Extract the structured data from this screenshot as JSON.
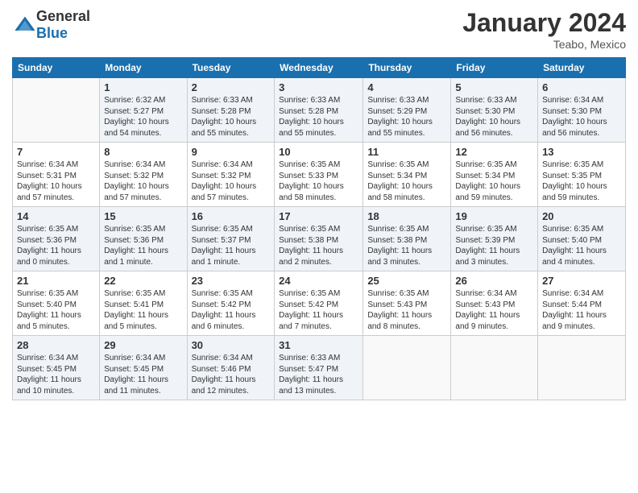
{
  "header": {
    "logo_general": "General",
    "logo_blue": "Blue",
    "month": "January 2024",
    "location": "Teabo, Mexico"
  },
  "days_of_week": [
    "Sunday",
    "Monday",
    "Tuesday",
    "Wednesday",
    "Thursday",
    "Friday",
    "Saturday"
  ],
  "weeks": [
    [
      {
        "day": "",
        "info": ""
      },
      {
        "day": "1",
        "info": "Sunrise: 6:32 AM\nSunset: 5:27 PM\nDaylight: 10 hours\nand 54 minutes."
      },
      {
        "day": "2",
        "info": "Sunrise: 6:33 AM\nSunset: 5:28 PM\nDaylight: 10 hours\nand 55 minutes."
      },
      {
        "day": "3",
        "info": "Sunrise: 6:33 AM\nSunset: 5:28 PM\nDaylight: 10 hours\nand 55 minutes."
      },
      {
        "day": "4",
        "info": "Sunrise: 6:33 AM\nSunset: 5:29 PM\nDaylight: 10 hours\nand 55 minutes."
      },
      {
        "day": "5",
        "info": "Sunrise: 6:33 AM\nSunset: 5:30 PM\nDaylight: 10 hours\nand 56 minutes."
      },
      {
        "day": "6",
        "info": "Sunrise: 6:34 AM\nSunset: 5:30 PM\nDaylight: 10 hours\nand 56 minutes."
      }
    ],
    [
      {
        "day": "7",
        "info": "Sunrise: 6:34 AM\nSunset: 5:31 PM\nDaylight: 10 hours\nand 57 minutes."
      },
      {
        "day": "8",
        "info": "Sunrise: 6:34 AM\nSunset: 5:32 PM\nDaylight: 10 hours\nand 57 minutes."
      },
      {
        "day": "9",
        "info": "Sunrise: 6:34 AM\nSunset: 5:32 PM\nDaylight: 10 hours\nand 57 minutes."
      },
      {
        "day": "10",
        "info": "Sunrise: 6:35 AM\nSunset: 5:33 PM\nDaylight: 10 hours\nand 58 minutes."
      },
      {
        "day": "11",
        "info": "Sunrise: 6:35 AM\nSunset: 5:34 PM\nDaylight: 10 hours\nand 58 minutes."
      },
      {
        "day": "12",
        "info": "Sunrise: 6:35 AM\nSunset: 5:34 PM\nDaylight: 10 hours\nand 59 minutes."
      },
      {
        "day": "13",
        "info": "Sunrise: 6:35 AM\nSunset: 5:35 PM\nDaylight: 10 hours\nand 59 minutes."
      }
    ],
    [
      {
        "day": "14",
        "info": "Sunrise: 6:35 AM\nSunset: 5:36 PM\nDaylight: 11 hours\nand 0 minutes."
      },
      {
        "day": "15",
        "info": "Sunrise: 6:35 AM\nSunset: 5:36 PM\nDaylight: 11 hours\nand 1 minute."
      },
      {
        "day": "16",
        "info": "Sunrise: 6:35 AM\nSunset: 5:37 PM\nDaylight: 11 hours\nand 1 minute."
      },
      {
        "day": "17",
        "info": "Sunrise: 6:35 AM\nSunset: 5:38 PM\nDaylight: 11 hours\nand 2 minutes."
      },
      {
        "day": "18",
        "info": "Sunrise: 6:35 AM\nSunset: 5:38 PM\nDaylight: 11 hours\nand 3 minutes."
      },
      {
        "day": "19",
        "info": "Sunrise: 6:35 AM\nSunset: 5:39 PM\nDaylight: 11 hours\nand 3 minutes."
      },
      {
        "day": "20",
        "info": "Sunrise: 6:35 AM\nSunset: 5:40 PM\nDaylight: 11 hours\nand 4 minutes."
      }
    ],
    [
      {
        "day": "21",
        "info": "Sunrise: 6:35 AM\nSunset: 5:40 PM\nDaylight: 11 hours\nand 5 minutes."
      },
      {
        "day": "22",
        "info": "Sunrise: 6:35 AM\nSunset: 5:41 PM\nDaylight: 11 hours\nand 5 minutes."
      },
      {
        "day": "23",
        "info": "Sunrise: 6:35 AM\nSunset: 5:42 PM\nDaylight: 11 hours\nand 6 minutes."
      },
      {
        "day": "24",
        "info": "Sunrise: 6:35 AM\nSunset: 5:42 PM\nDaylight: 11 hours\nand 7 minutes."
      },
      {
        "day": "25",
        "info": "Sunrise: 6:35 AM\nSunset: 5:43 PM\nDaylight: 11 hours\nand 8 minutes."
      },
      {
        "day": "26",
        "info": "Sunrise: 6:34 AM\nSunset: 5:43 PM\nDaylight: 11 hours\nand 9 minutes."
      },
      {
        "day": "27",
        "info": "Sunrise: 6:34 AM\nSunset: 5:44 PM\nDaylight: 11 hours\nand 9 minutes."
      }
    ],
    [
      {
        "day": "28",
        "info": "Sunrise: 6:34 AM\nSunset: 5:45 PM\nDaylight: 11 hours\nand 10 minutes."
      },
      {
        "day": "29",
        "info": "Sunrise: 6:34 AM\nSunset: 5:45 PM\nDaylight: 11 hours\nand 11 minutes."
      },
      {
        "day": "30",
        "info": "Sunrise: 6:34 AM\nSunset: 5:46 PM\nDaylight: 11 hours\nand 12 minutes."
      },
      {
        "day": "31",
        "info": "Sunrise: 6:33 AM\nSunset: 5:47 PM\nDaylight: 11 hours\nand 13 minutes."
      },
      {
        "day": "",
        "info": ""
      },
      {
        "day": "",
        "info": ""
      },
      {
        "day": "",
        "info": ""
      }
    ]
  ]
}
